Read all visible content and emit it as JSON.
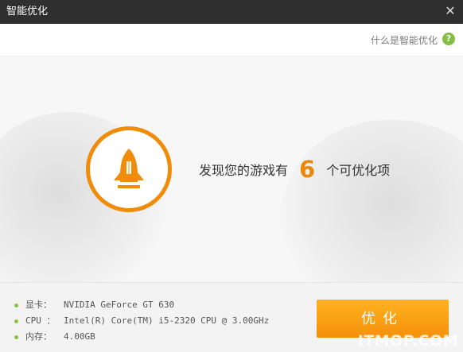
{
  "window": {
    "title": "智能优化",
    "close_icon": "close-icon"
  },
  "header": {
    "help_text": "什么是智能优化",
    "help_icon": "question-circle-icon",
    "help_icon_text": "?"
  },
  "summary": {
    "prefix": "发现您的游戏有",
    "count": "6",
    "suffix": "个可优化项"
  },
  "system_info": [
    {
      "label": "显卡：",
      "value": "NVIDIA GeForce GT 630"
    },
    {
      "label": "CPU ：",
      "value": "Intel(R) Core(TM) i5-2320 CPU @ 3.00GHz"
    },
    {
      "label": "内存：",
      "value": "4.00GB"
    }
  ],
  "actions": {
    "optimize_label": "优化"
  },
  "watermark": {
    "text": "ITMOP.COM"
  },
  "colors": {
    "accent": "#f08c0a",
    "bullet": "#86c440",
    "titlebar": "#2f2f2f",
    "help_icon": "#82bf42"
  }
}
